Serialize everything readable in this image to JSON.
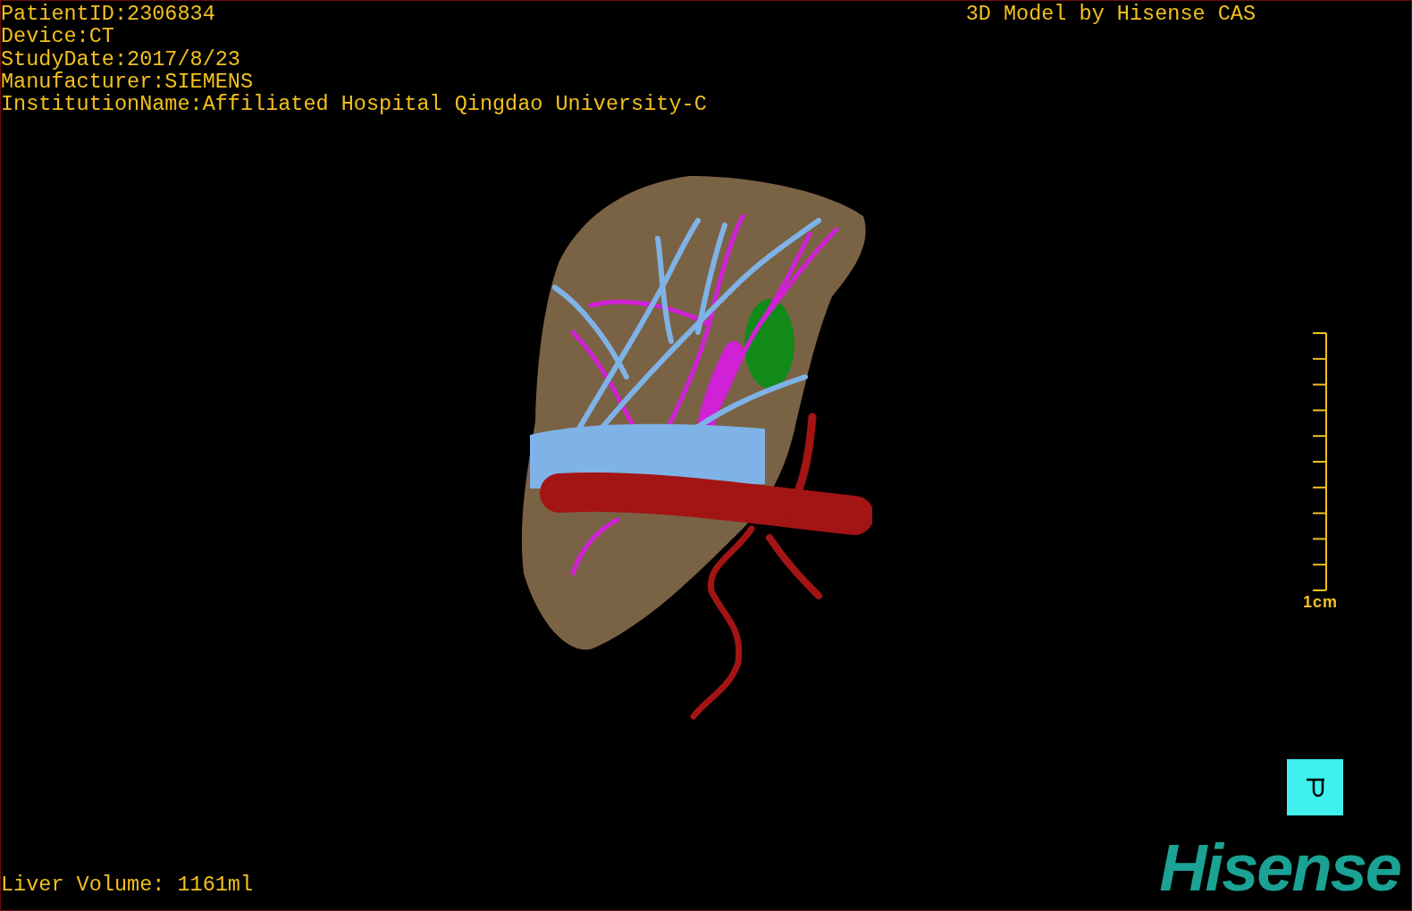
{
  "header": {
    "info_lines": [
      "PatientID:2306834",
      "Device:CT",
      "StudyDate:2017/8/23",
      "Manufacturer:SIEMENS",
      "InstitutionName:Affiliated Hospital Qingdao University-C"
    ],
    "title": "3D Model by Hisense CAS"
  },
  "scale_bar": {
    "label": "1cm"
  },
  "footer": {
    "volume": "Liver Volume: 1161ml",
    "logo": "Hisense"
  }
}
